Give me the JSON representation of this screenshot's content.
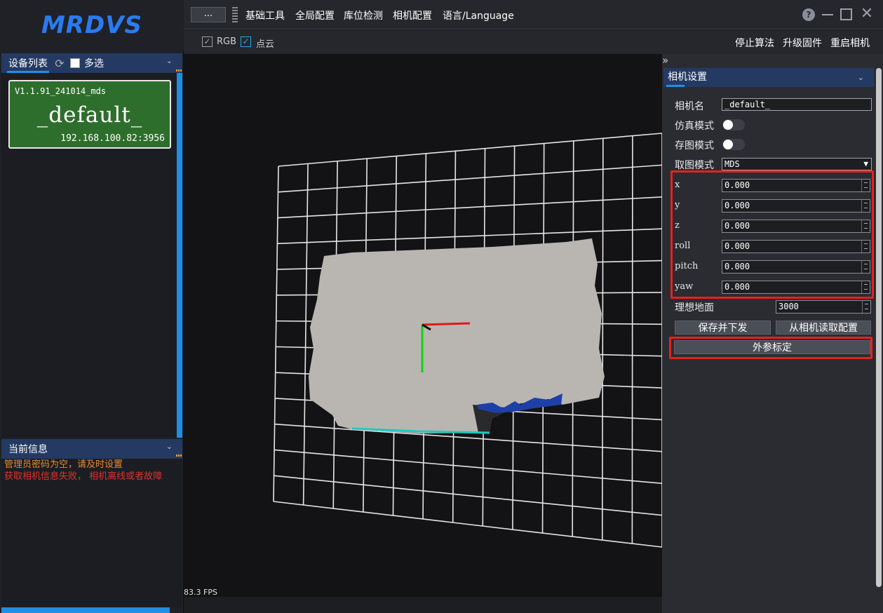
{
  "brand": {
    "logo_text": "MRDVS"
  },
  "device_panel": {
    "title": "设备列表",
    "multi_select_label": "多选",
    "device": {
      "version": "V1.1.91_241014_mds",
      "name": "_default_",
      "address": "192.168.100.82:3956",
      "color": "#2e6e2c"
    }
  },
  "info_panel": {
    "title": "当前信息",
    "messages": [
      "管理员密码为空，请及时设置",
      "获取相机信息失败， 相机离线或者故障"
    ]
  },
  "menubar": {
    "more_label": "...",
    "items": [
      "基础工具",
      "全局配置",
      "库位检测",
      "相机配置",
      "语言/Language"
    ],
    "help_label": "?"
  },
  "toolbar": {
    "rgb_label": "RGB",
    "rgb_checked": true,
    "cloud_label": "点云",
    "cloud_checked": true,
    "actions": [
      "停止算法",
      "升级固件",
      "重启相机"
    ]
  },
  "viewport": {
    "fps": "83.3 FPS"
  },
  "camera_settings": {
    "title": "相机设置",
    "camera_name_label": "相机名",
    "camera_name_value": "_default_",
    "sim_mode_label": "仿真模式",
    "sim_mode_on": false,
    "save_image_label": "存图模式",
    "save_image_on": false,
    "capture_mode_label": "取图模式",
    "capture_mode_value": "MDS",
    "params": [
      {
        "label": "x",
        "value": "0.000"
      },
      {
        "label": "y",
        "value": "0.000"
      },
      {
        "label": "z",
        "value": "0.000"
      },
      {
        "label": "roll",
        "value": "0.000"
      },
      {
        "label": "pitch",
        "value": "0.000"
      },
      {
        "label": "yaw",
        "value": "0.000"
      }
    ],
    "ideal_ground_label": "理想地面",
    "ideal_ground_value": "3000",
    "save_button": "保存并下发",
    "read_button": "从相机读取配置",
    "calibrate_button": "外参标定"
  },
  "colors": {
    "accent": "#1e90e8",
    "panel_header": "#243a63",
    "highlight": "#e5211d",
    "warning": "#e8892b",
    "error": "#e0322a"
  }
}
